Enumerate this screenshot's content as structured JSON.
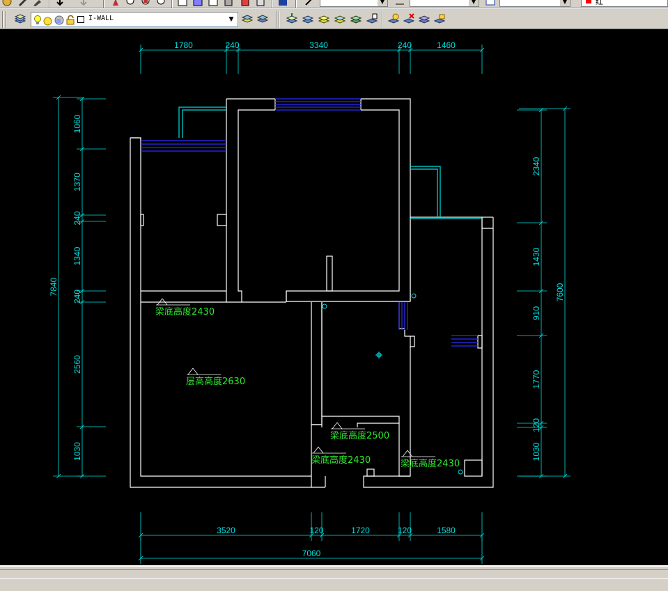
{
  "toolbar2": {
    "layer_name": "I-WALL"
  },
  "toolbar1": {
    "color_text": "红"
  },
  "drawing": {
    "top_dims": [
      "1780",
      "240",
      "3340",
      "240",
      "1460"
    ],
    "bottom_dims": [
      "3520",
      "120",
      "1720",
      "120",
      "1580"
    ],
    "bottom_total": "7060",
    "left_dims": [
      "1060",
      "1370",
      "240",
      "1340",
      "240",
      "2560",
      "1030"
    ],
    "left_total": "7840",
    "right_dims": [
      "2340",
      "1430",
      "910",
      "1770",
      "120",
      "1030"
    ],
    "right_total": "7600",
    "annotations": [
      "梁底高度2430",
      "层高高度2630",
      "梁底高度2500",
      "梁底高度2430",
      "梁底高度2430"
    ]
  },
  "colors": {
    "wall": "#ffffff",
    "dimension": "#00e0e0",
    "annotation": "#2ee82e",
    "window": "#2b2bff",
    "background": "#000000"
  }
}
